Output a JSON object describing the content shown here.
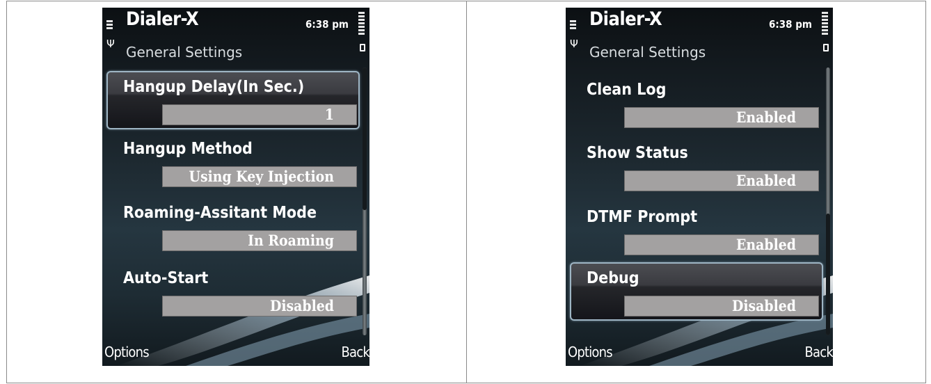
{
  "screens": [
    {
      "app_title": "Dialer-X",
      "subtitle": "General Settings",
      "time": "6:38 pm",
      "settings": [
        {
          "label": "Hangup Delay(In Sec.)",
          "value": "1",
          "selected": true
        },
        {
          "label": "Hangup Method",
          "value": "Using Key Injection",
          "selected": false
        },
        {
          "label": "Roaming-Assitant Mode",
          "value": "In Roaming",
          "selected": false
        },
        {
          "label": "Auto-Start",
          "value": "Disabled",
          "selected": false
        }
      ],
      "scroll_position": 0.0,
      "softkeys": {
        "left": "Options",
        "right": "Back"
      }
    },
    {
      "app_title": "Dialer-X",
      "subtitle": "General Settings",
      "time": "6:38 pm",
      "settings": [
        {
          "label": "Clean Log",
          "value": "Enabled",
          "selected": false
        },
        {
          "label": "Show Status",
          "value": "Enabled",
          "selected": false
        },
        {
          "label": "DTMF Prompt",
          "value": "Enabled",
          "selected": false
        },
        {
          "label": "Debug",
          "value": "Disabled",
          "selected": true
        }
      ],
      "scroll_position": 1.0,
      "softkeys": {
        "left": "Options",
        "right": "Back"
      }
    }
  ],
  "icons": {
    "signal": "signal-strength-icon",
    "antenna": "antenna-icon",
    "battery": "battery-icon"
  },
  "colors": {
    "value_box": "#a3a1a1",
    "selection_border": "#9eb5c4",
    "background_dark": "#141b20"
  }
}
